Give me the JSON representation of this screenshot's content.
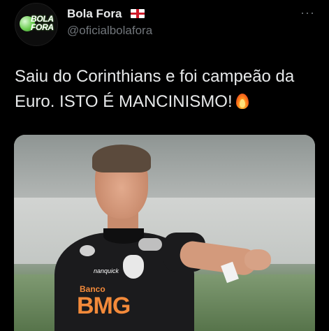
{
  "author": {
    "display_name": "Bola Fora",
    "handle": "@oficialbolafora",
    "avatar_logo_lines": [
      "BOLA",
      "FORA"
    ]
  },
  "menu": {
    "more_glyph": "···"
  },
  "tweet": {
    "text": "Saiu do Corinthians e foi campeão da Euro. ISTO É MANCINISMO!",
    "emoji": "fire"
  },
  "media": {
    "sponsor_small": "Banco",
    "sponsor_big": "BMG",
    "brand_small": "nanquick"
  },
  "colors": {
    "background": "#000000",
    "primary_text": "#e7e9ea",
    "secondary_text": "#71767b",
    "sponsor_orange": "#f38a3a"
  }
}
